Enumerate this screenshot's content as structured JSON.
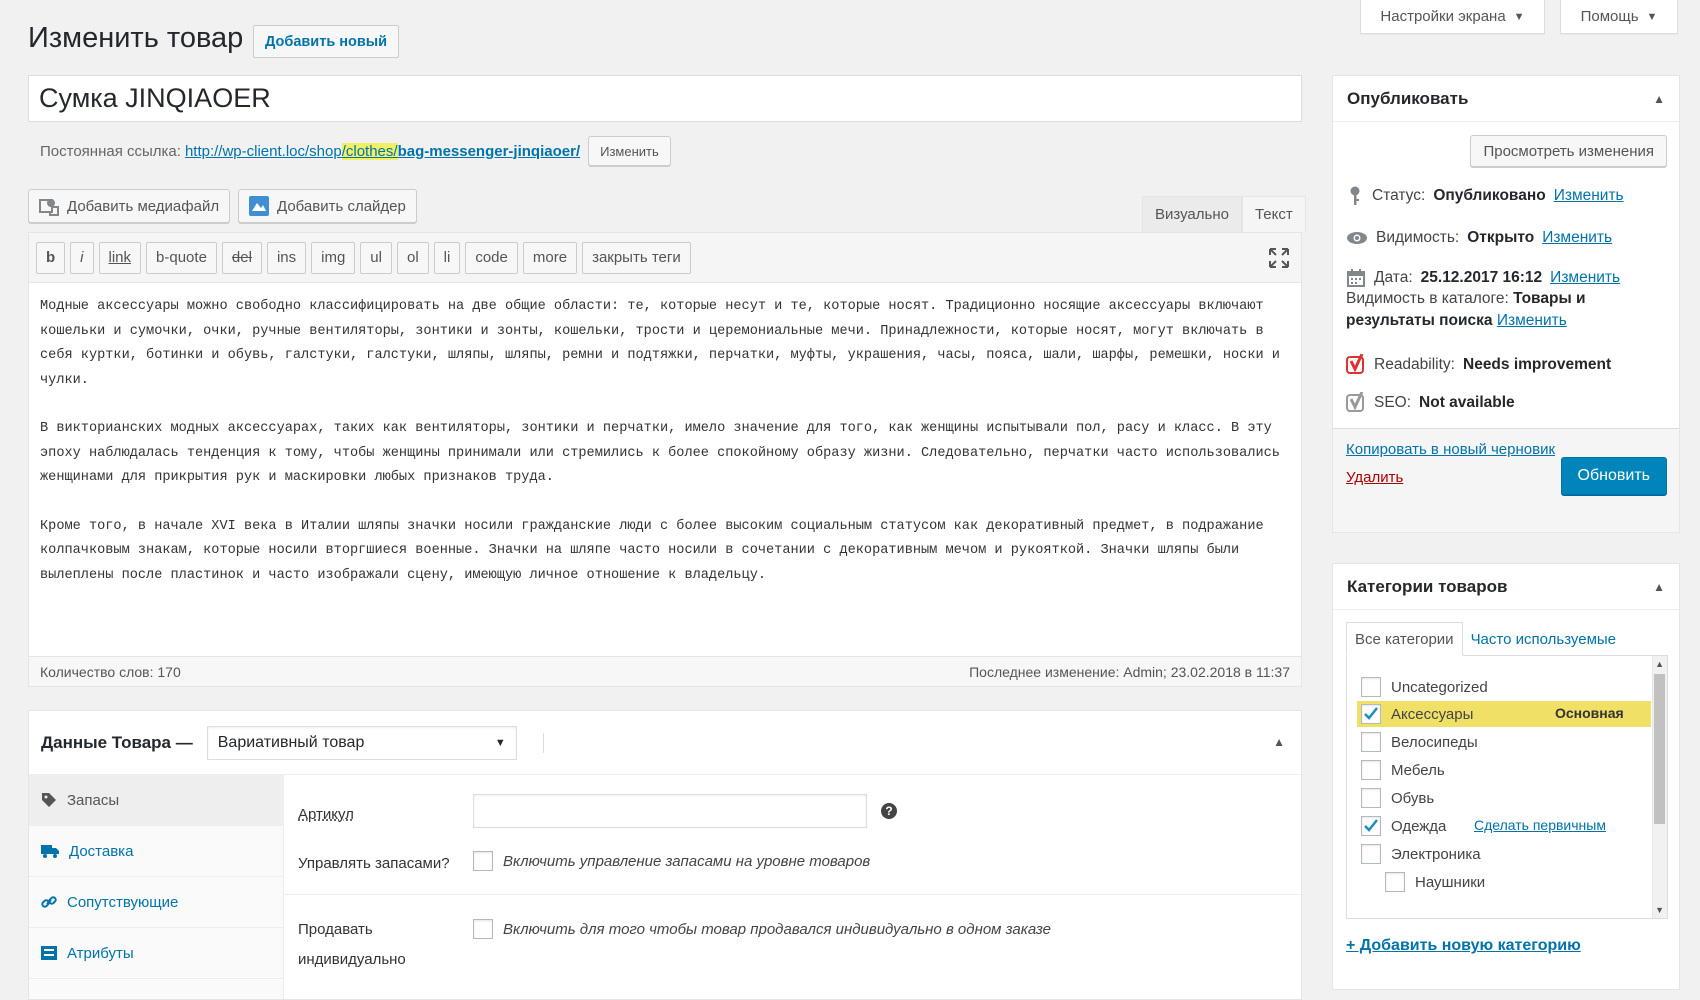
{
  "screen_meta": {
    "options_label": "Настройки экрана",
    "help_label": "Помощь"
  },
  "page": {
    "title": "Изменить товар",
    "add_new": "Добавить новый"
  },
  "post": {
    "title": "Сумка JINQIAOER",
    "permalink_label": "Постоянная ссылка:",
    "permalink_base": "http://wp-client.loc/shop",
    "permalink_cat": "/clothes/",
    "permalink_slug": "bag-messenger-jinqiaoer/",
    "permalink_edit": "Изменить"
  },
  "media": {
    "add_media": "Добавить медиафайл",
    "add_slider": "Добавить слайдер"
  },
  "editor": {
    "tab_visual": "Визуально",
    "tab_text": "Текст",
    "quicktags": [
      "b",
      "i",
      "link",
      "b-quote",
      "del",
      "ins",
      "img",
      "ul",
      "ol",
      "li",
      "code",
      "more",
      "закрыть теги"
    ],
    "paragraphs": [
      "Модные аксессуары можно свободно классифицировать на две общие области: те, которые несут и те, которые носят. Традиционно носящие аксессуары включают кошельки и сумочки, очки, ручные вентиляторы, зонтики и зонты, кошельки, трости и церемониальные мечи. Принадлежности, которые носят, могут включать в себя куртки, ботинки и обувь, галстуки, галстуки, шляпы, шляпы, ремни и подтяжки, перчатки, муфты, украшения, часы, пояса, шали, шарфы, ремешки, носки и чулки.",
      "В викторианских модных аксессуарах, таких как вентиляторы, зонтики и перчатки, имело значение для того, как женщины испытывали пол, расу и класс. В эту эпоху наблюдалась тенденция к тому, чтобы женщины принимали или стремились к более спокойному образу жизни. Следовательно, перчатки часто использовались женщинами для прикрытия рук и маскировки любых признаков труда.",
      "Кроме того, в начале XVI века в Италии шляпы значки носили гражданские люди с более высоким социальным статусом как декоративный предмет, в подражание колпачковым знакам, которые носили вторгшиеся военные. Значки на шляпе часто носили в сочетании с декоративным мечом и рукояткой. Значки шляпы были вылеплены после пластинок и часто изображали сцену, имеющую личное отношение к владельцу."
    ],
    "word_count": "Количество слов: 170",
    "last_edit": "Последнее изменение: Admin; 23.02.2018 в 11:37"
  },
  "product_data": {
    "heading": "Данные Товара —",
    "type_selected": "Вариативный товар",
    "tabs": [
      "Запасы",
      "Доставка",
      "Сопутствующие",
      "Атрибуты"
    ],
    "sku_label": "Артикул",
    "manage_stock_label": "Управлять запасами?",
    "manage_stock_desc": "Включить управление запасами на уровне товаров",
    "sold_individually_label_1": "Продавать",
    "sold_individually_label_2": "индивидуально",
    "sold_individually_desc": "Включить для того чтобы товар продавался индивидуально в одном заказе"
  },
  "publish": {
    "title": "Опубликовать",
    "preview": "Просмотреть изменения",
    "status_label": "Статус:",
    "status_value": "Опубликовано",
    "visibility_label": "Видимость:",
    "visibility_value": "Открыто",
    "date_label": "Дата:",
    "date_value": "25.12.2017 16:12",
    "catalog_label": "Видимость в каталоге:",
    "catalog_value_1": "Товары и",
    "catalog_value_2": "результаты поиска",
    "readability_label": "Readability:",
    "readability_value": "Needs improvement",
    "seo_label": "SEO:",
    "seo_value": "Not available",
    "edit_link": "Изменить",
    "copy_draft": "Копировать в новый черновик",
    "trash": "Удалить",
    "update": "Обновить"
  },
  "categories": {
    "title": "Категории товаров",
    "tab_all": "Все категории",
    "tab_popular": "Часто используемые",
    "items": [
      {
        "label": "Uncategorized",
        "checked": false
      },
      {
        "label": "Аксессуары",
        "checked": true,
        "note": "Основная"
      },
      {
        "label": "Велосипеды",
        "checked": false
      },
      {
        "label": "Мебель",
        "checked": false
      },
      {
        "label": "Обувь",
        "checked": false
      },
      {
        "label": "Одежда",
        "checked": true,
        "note": "Сделать первичным"
      },
      {
        "label": "Электроника",
        "checked": false
      },
      {
        "label": "Наушники",
        "checked": false
      }
    ],
    "add_new": "+ Добавить новую категорию"
  },
  "colors": {
    "accent": "#0073aa",
    "primary_button": "#0085ba",
    "highlight": "#f0e066",
    "trash": "#a00"
  }
}
